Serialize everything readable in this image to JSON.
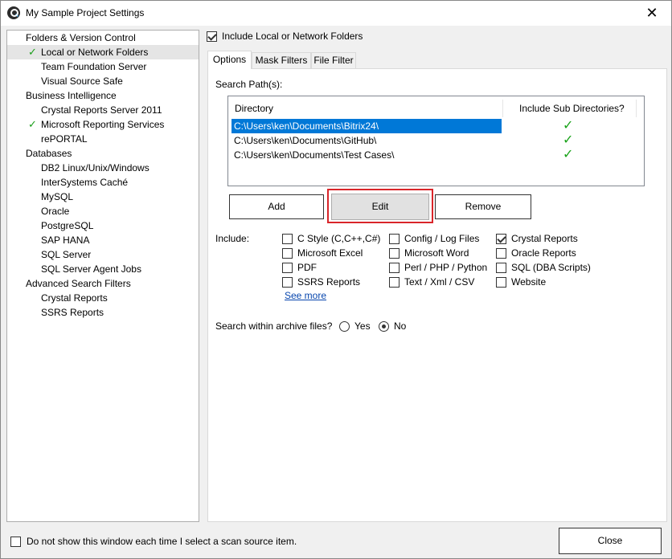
{
  "window": {
    "title": "My Sample Project Settings"
  },
  "tree": {
    "items": [
      {
        "label": "Folders & Version Control",
        "checked": false,
        "selected": false
      },
      {
        "label": "Local or Network Folders",
        "checked": true,
        "selected": true
      },
      {
        "label": "Team Foundation Server",
        "checked": false,
        "selected": false
      },
      {
        "label": "Visual Source Safe",
        "checked": false,
        "selected": false
      },
      {
        "label": "Business Intelligence",
        "checked": false,
        "selected": false
      },
      {
        "label": "Crystal Reports Server 2011",
        "checked": false,
        "selected": false
      },
      {
        "label": "Microsoft Reporting Services",
        "checked": true,
        "selected": false
      },
      {
        "label": "rePORTAL",
        "checked": false,
        "selected": false
      },
      {
        "label": "Databases",
        "checked": false,
        "selected": false
      },
      {
        "label": "DB2 Linux/Unix/Windows",
        "checked": false,
        "selected": false
      },
      {
        "label": "InterSystems Caché",
        "checked": false,
        "selected": false
      },
      {
        "label": "MySQL",
        "checked": false,
        "selected": false
      },
      {
        "label": "Oracle",
        "checked": false,
        "selected": false
      },
      {
        "label": "PostgreSQL",
        "checked": false,
        "selected": false
      },
      {
        "label": "SAP HANA",
        "checked": false,
        "selected": false
      },
      {
        "label": "SQL Server",
        "checked": false,
        "selected": false
      },
      {
        "label": "SQL Server Agent Jobs",
        "checked": false,
        "selected": false
      },
      {
        "label": "Advanced Search Filters",
        "checked": false,
        "selected": false
      },
      {
        "label": "Crystal Reports",
        "checked": false,
        "selected": false
      },
      {
        "label": "SSRS Reports",
        "checked": false,
        "selected": false
      }
    ]
  },
  "main": {
    "include_local_label": "Include Local or Network Folders",
    "include_local_checked": true,
    "tabs": [
      {
        "label": "Options",
        "active": true
      },
      {
        "label": "Mask Filters",
        "active": false
      },
      {
        "label": "File Filter",
        "active": false
      }
    ],
    "search_paths_label": "Search Path(s):",
    "list": {
      "columns": [
        "Directory",
        "Include Sub Directories?"
      ],
      "rows": [
        {
          "directory": "C:\\Users\\ken\\Documents\\Bitrix24\\",
          "include_sub": true,
          "selected": true
        },
        {
          "directory": "C:\\Users\\ken\\Documents\\GitHub\\",
          "include_sub": true,
          "selected": false
        },
        {
          "directory": "C:\\Users\\ken\\Documents\\Test Cases\\",
          "include_sub": true,
          "selected": false
        }
      ]
    },
    "buttons": {
      "add": "Add",
      "edit": "Edit",
      "remove": "Remove"
    },
    "include_label": "Include:",
    "include_options": [
      {
        "label": "C Style (C,C++,C#)",
        "checked": false
      },
      {
        "label": "Config / Log Files",
        "checked": false
      },
      {
        "label": "Crystal Reports",
        "checked": true
      },
      {
        "label": "Microsoft Excel",
        "checked": false
      },
      {
        "label": "Microsoft Word",
        "checked": false
      },
      {
        "label": "Oracle Reports",
        "checked": false
      },
      {
        "label": "PDF",
        "checked": false
      },
      {
        "label": "Perl / PHP / Python",
        "checked": false
      },
      {
        "label": "SQL (DBA Scripts)",
        "checked": false
      },
      {
        "label": "SSRS Reports",
        "checked": false
      },
      {
        "label": "Text / Xml / CSV",
        "checked": false
      },
      {
        "label": "Website",
        "checked": false
      }
    ],
    "see_more": "See more",
    "archive_label": "Search within archive files?",
    "archive_options": [
      {
        "label": "Yes",
        "checked": false
      },
      {
        "label": "No",
        "checked": true
      }
    ]
  },
  "footer": {
    "dont_show_label": "Do not show this window each time I select a scan source item.",
    "dont_show_checked": false,
    "close_label": "Close"
  },
  "colors": {
    "selection": "#0078d7",
    "check_green": "#1aa31a",
    "highlight_red": "#d9252a"
  }
}
